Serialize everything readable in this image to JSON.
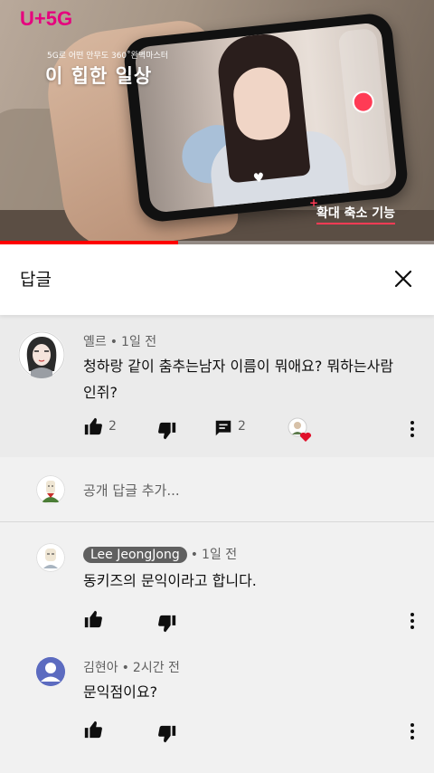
{
  "video": {
    "brand_logo": "U+5G",
    "sub_caption": "5G로 어떤 안무도 360˚완벽마스터",
    "main_caption": "이 힙한 일상",
    "feature_label": "확대 축소 기능",
    "progress_fraction": 0.41
  },
  "header": {
    "title": "답글",
    "close_icon": "close-icon"
  },
  "root_comment": {
    "author": "옐르",
    "time": "1일 전",
    "text_line1": "청하랑 같이 춤추는남자 이름이 뭐애요? 뭐하는사람",
    "text_line2": "인쥐?",
    "like_count": "2",
    "reply_count": "2",
    "icons": [
      "like-icon",
      "dislike-icon",
      "reply-icon",
      "creator-heart-icon",
      "more-icon"
    ]
  },
  "add_reply": {
    "placeholder": "공개 답글 추가..."
  },
  "replies": [
    {
      "author": "Lee JeongJong",
      "time": "1일 전",
      "text": "동키즈의 문익이라고 합니다.",
      "author_is_creator": true
    },
    {
      "author": "김현아",
      "time": "2시간 전",
      "text": "문익점이요?",
      "author_is_creator": false
    }
  ],
  "colors": {
    "accent_red": "#ff0000",
    "brand_magenta": "#e6007e",
    "background": "#f1f1f1",
    "highlight_background": "#ebebeb",
    "creator_chip": "#606060"
  }
}
